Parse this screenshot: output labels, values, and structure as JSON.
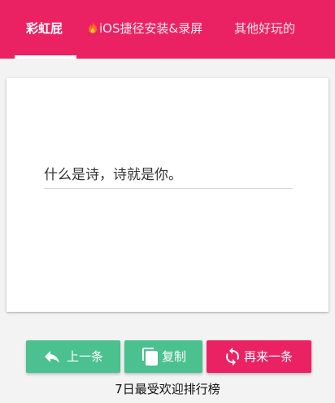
{
  "tabs": [
    {
      "label": "彩虹屁",
      "active": true
    },
    {
      "label": "iOS捷径安装&录屏",
      "icon": "fire-icon"
    },
    {
      "label": "其他好玩的"
    }
  ],
  "quote": {
    "text": "什么是诗，诗就是你。"
  },
  "buttons": {
    "prev": {
      "label": "上一条",
      "icon": "reply-arrow-icon"
    },
    "copy": {
      "label": "复制",
      "icon": "copy-icon"
    },
    "next": {
      "label": "再来一条",
      "icon": "refresh-icon"
    }
  },
  "ranking_link": "7日最受欢迎排行榜",
  "colors": {
    "primary": "#ea2264",
    "green": "#4ac18e",
    "background": "#f3f3f3"
  }
}
